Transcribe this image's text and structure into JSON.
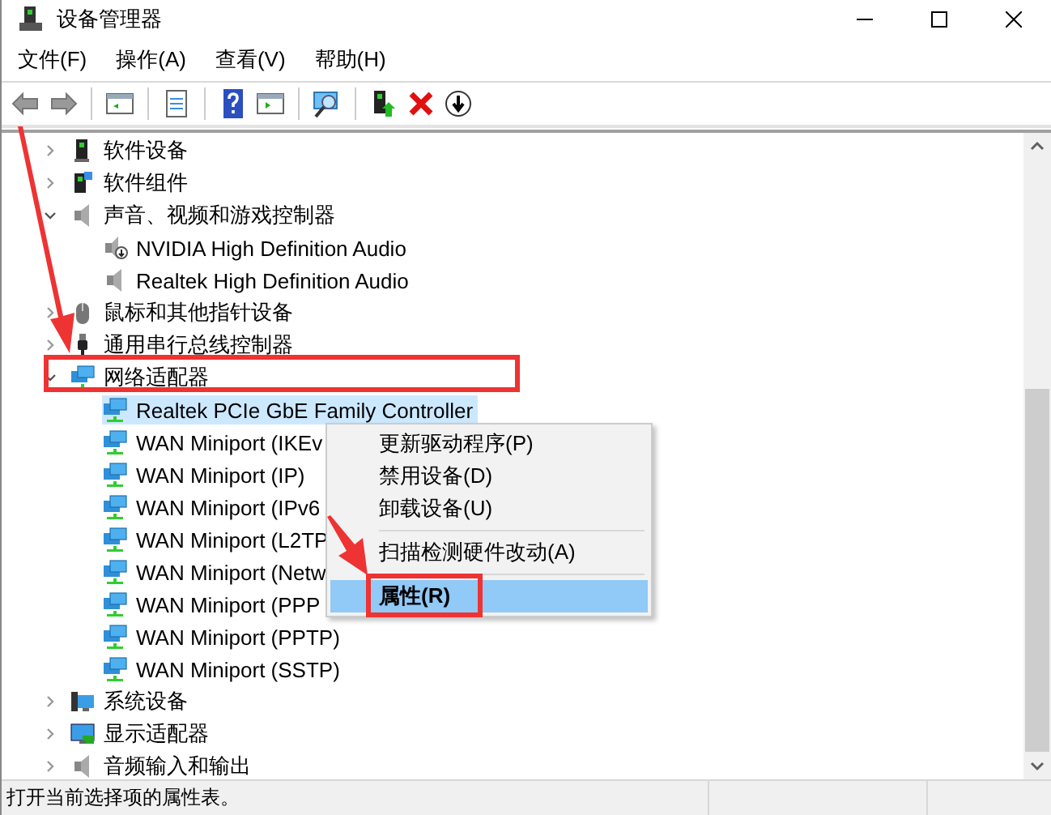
{
  "window": {
    "title": "设备管理器"
  },
  "menu_bar": [
    "文件(F)",
    "操作(A)",
    "查看(V)",
    "帮助(H)"
  ],
  "tree": [
    {
      "label": "软件设备",
      "kind": "chip",
      "expanded": false,
      "selected": false
    },
    {
      "label": "软件组件",
      "kind": "component",
      "expanded": false,
      "selected": false
    },
    {
      "label": "声音、视频和游戏控制器",
      "kind": "speaker",
      "expanded": true,
      "selected": false,
      "children": [
        {
          "label": "NVIDIA High Definition Audio",
          "kind": "speaker-driver",
          "selected": false
        },
        {
          "label": "Realtek High Definition Audio",
          "kind": "speaker",
          "selected": false
        }
      ]
    },
    {
      "label": "鼠标和其他指针设备",
      "kind": "mouse",
      "expanded": false,
      "selected": false
    },
    {
      "label": "通用串行总线控制器",
      "kind": "usb",
      "expanded": false,
      "selected": false
    },
    {
      "label": "网络适配器",
      "kind": "network",
      "expanded": true,
      "selected": false,
      "children": [
        {
          "label": "Realtek PCIe GbE Family Controller",
          "kind": "network",
          "selected": true
        },
        {
          "label": "WAN Miniport (IKEv",
          "kind": "network",
          "selected": false
        },
        {
          "label": "WAN Miniport (IP)",
          "kind": "network",
          "selected": false
        },
        {
          "label": "WAN Miniport (IPv6",
          "kind": "network",
          "selected": false
        },
        {
          "label": "WAN Miniport (L2TP",
          "kind": "network",
          "selected": false
        },
        {
          "label": "WAN Miniport (Netw",
          "kind": "network",
          "selected": false
        },
        {
          "label": "WAN Miniport (PPP",
          "kind": "network",
          "selected": false
        },
        {
          "label": "WAN Miniport (PPTP)",
          "kind": "network",
          "selected": false
        },
        {
          "label": "WAN Miniport (SSTP)",
          "kind": "network",
          "selected": false
        }
      ]
    },
    {
      "label": "系统设备",
      "kind": "system",
      "expanded": false,
      "selected": false
    },
    {
      "label": "显示适配器",
      "kind": "display",
      "expanded": false,
      "selected": false
    },
    {
      "label": "音频输入和输出",
      "kind": "speaker",
      "expanded": false,
      "selected": false
    }
  ],
  "context_menu": {
    "groups": [
      [
        {
          "label": "更新驱动程序(P)",
          "selected": false,
          "default": false
        },
        {
          "label": "禁用设备(D)",
          "selected": false,
          "default": false
        },
        {
          "label": "卸载设备(U)",
          "selected": false,
          "default": false
        }
      ],
      [
        {
          "label": "扫描检测硬件改动(A)",
          "selected": false,
          "default": false
        }
      ],
      [
        {
          "label": "属性(R)",
          "selected": true,
          "default": true
        }
      ]
    ]
  },
  "status_bar": {
    "text": "打开当前选择项的属性表。"
  }
}
